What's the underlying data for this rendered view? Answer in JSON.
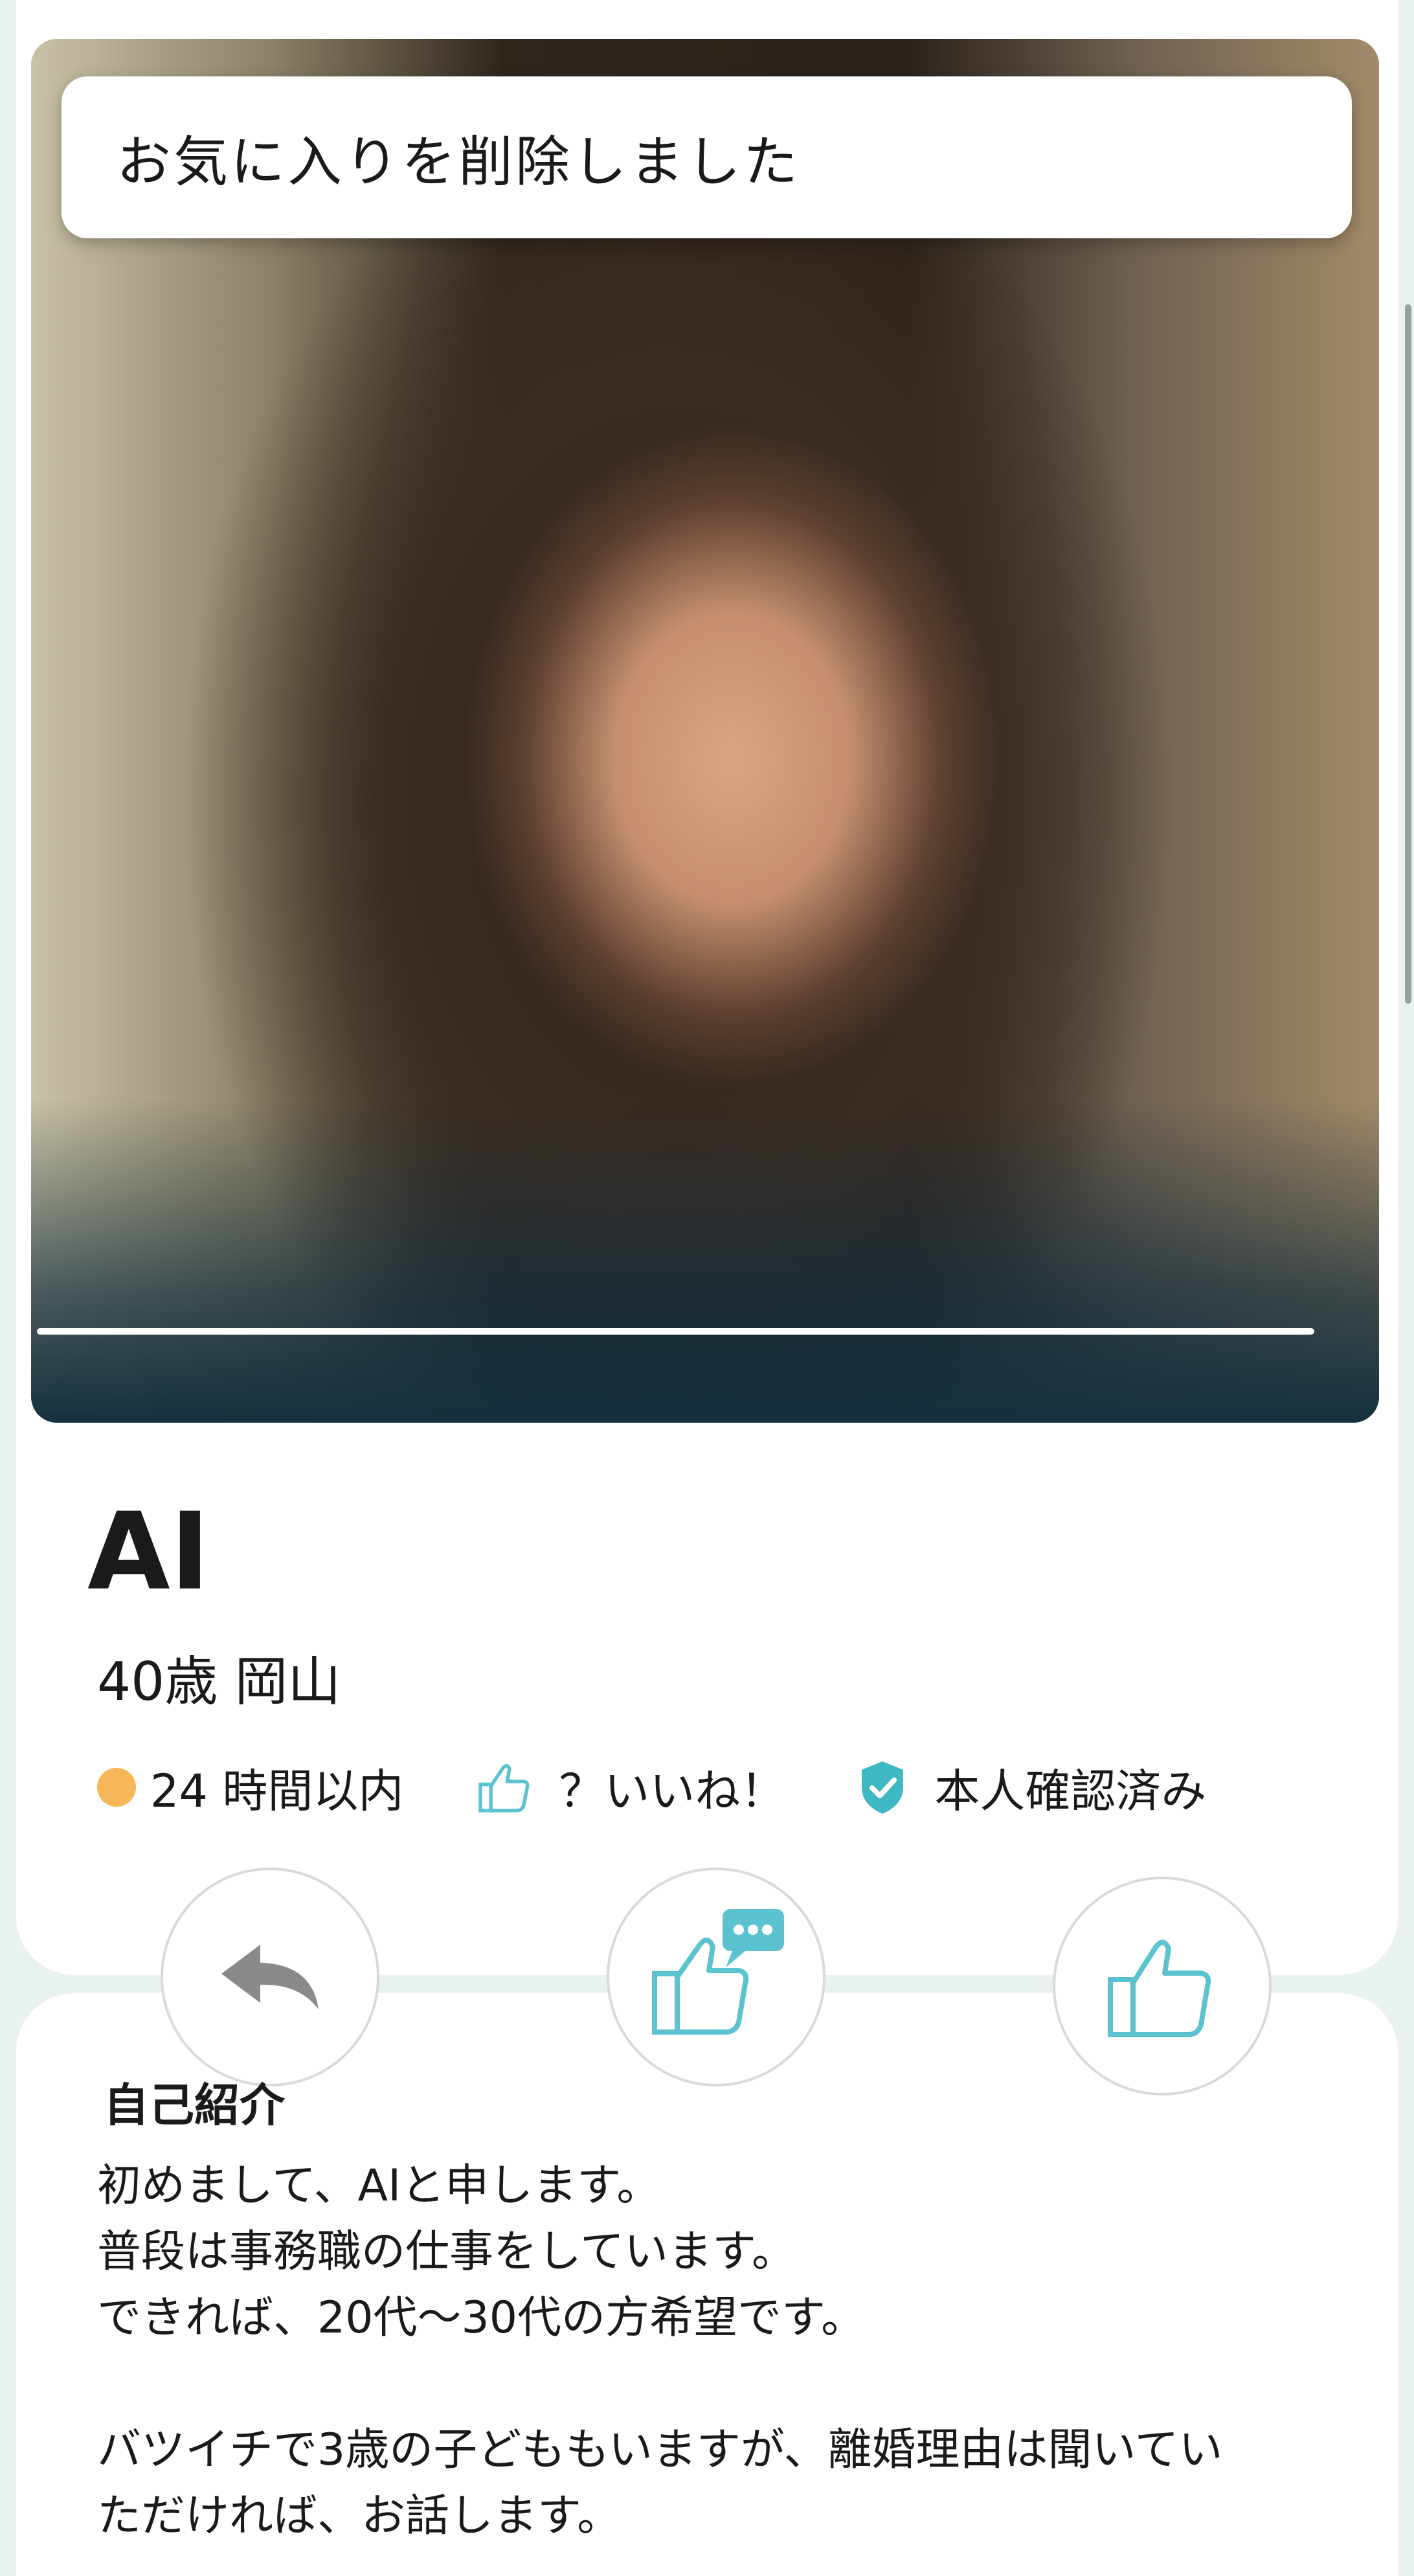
{
  "toast": {
    "message": "お気に入りを削除しました"
  },
  "profile": {
    "name": "AI",
    "age_area": "40歳 岡山",
    "status": {
      "login": "24 時間以内",
      "likes": "？いいね！",
      "verified": "本人確認済み"
    },
    "colors": {
      "accent": "#5bc3cf",
      "online_dot": "#f7b657"
    }
  },
  "actions": [
    {
      "icon": "back-arrow-icon"
    },
    {
      "icon": "like-with-message-icon"
    },
    {
      "icon": "like-icon"
    }
  ],
  "intro": {
    "title": "自己紹介",
    "text": "初めまして、AIと申します。\n普段は事務職の仕事をしています。\nできれば、20代〜30代の方希望です。\n\nバツイチで3歳の子どももいますが、離婚理由は聞いてい\nただければ、お話します。"
  }
}
